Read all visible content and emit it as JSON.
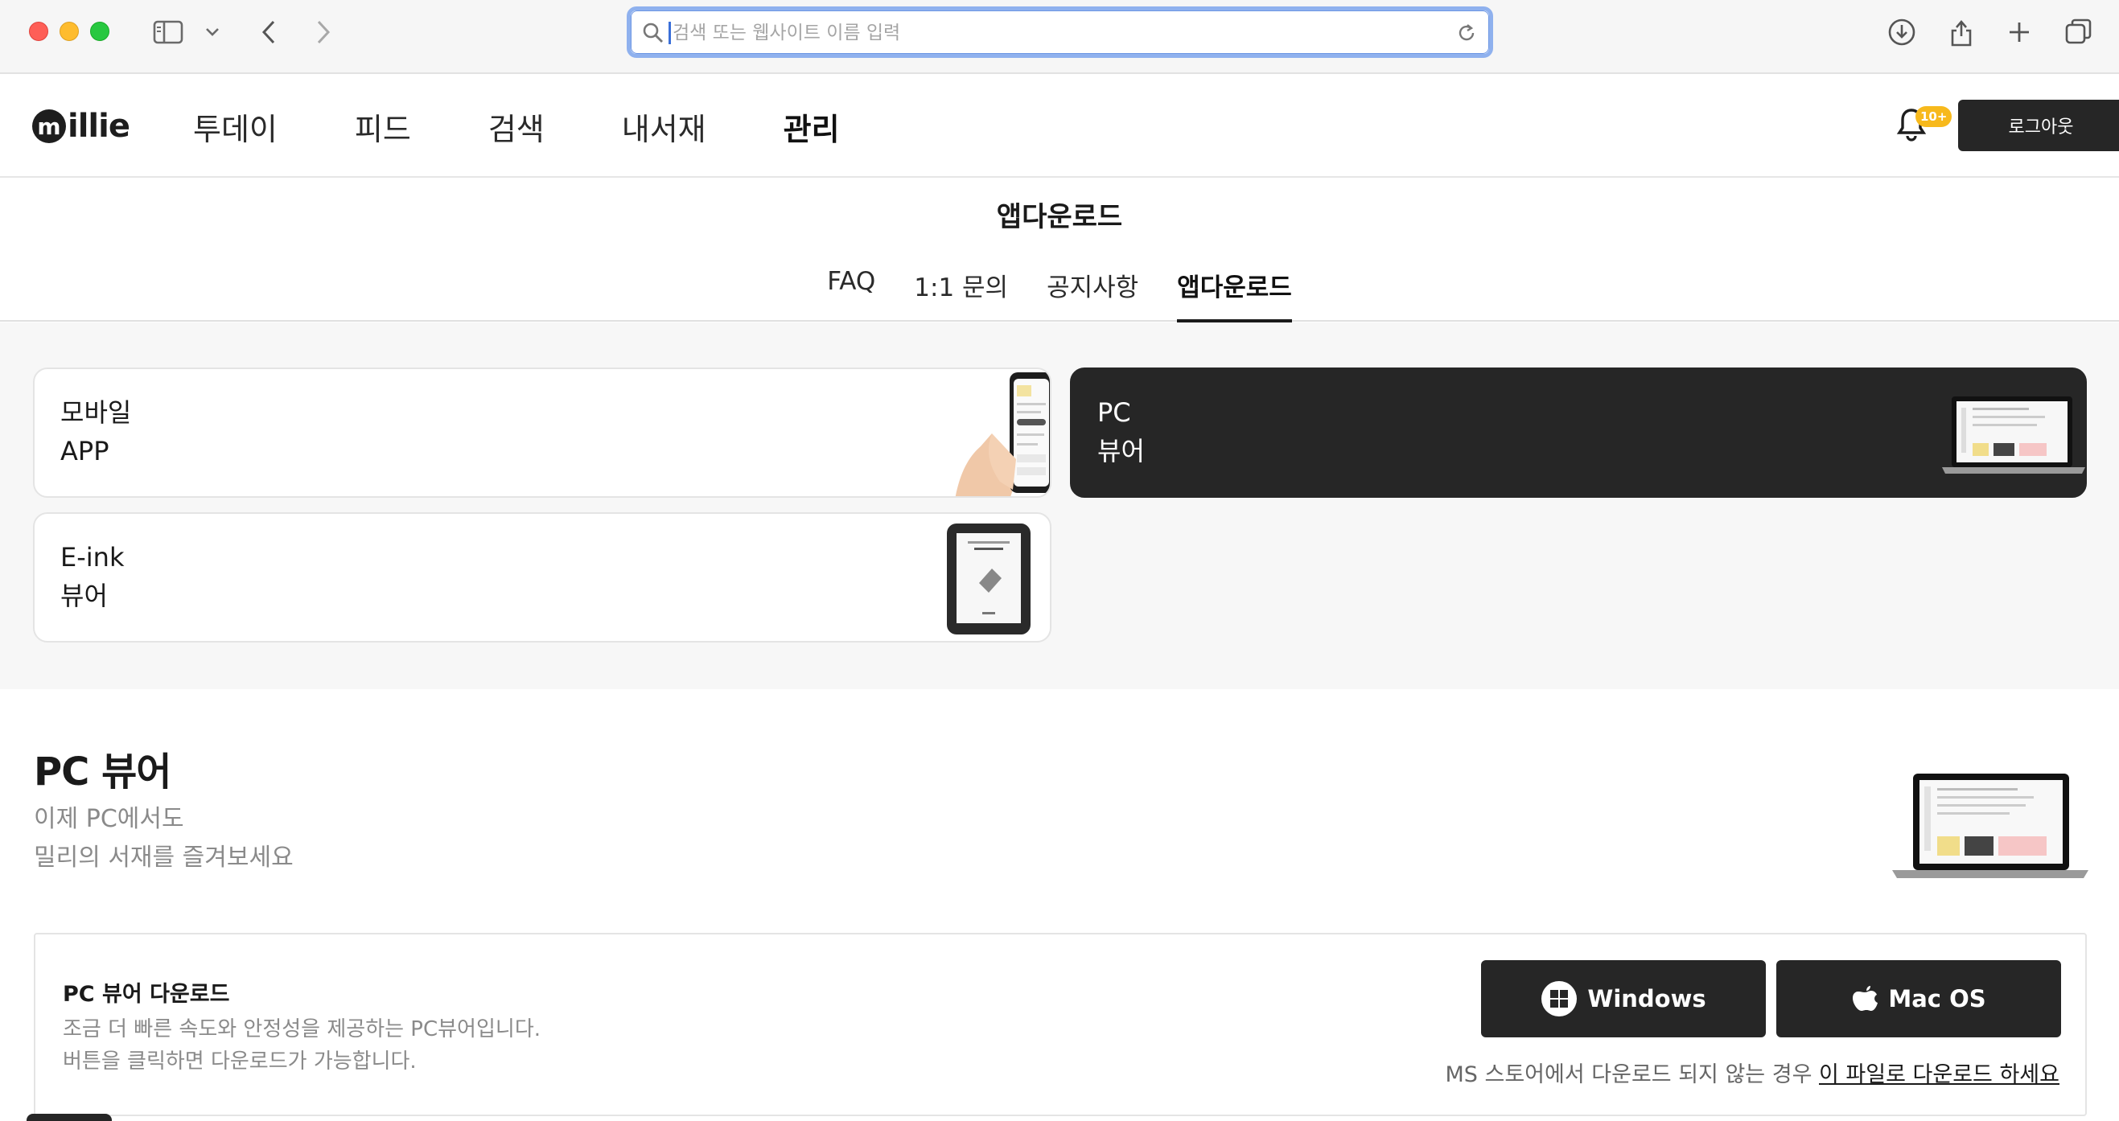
{
  "browser": {
    "address_placeholder": "검색 또는 웹사이트 이름 입력"
  },
  "site": {
    "logo_mark": "m",
    "logo_text": "illie",
    "nav": [
      {
        "label": "투데이"
      },
      {
        "label": "피드"
      },
      {
        "label": "검색"
      },
      {
        "label": "내서재"
      },
      {
        "label": "관리",
        "active": true
      }
    ],
    "notification_badge": "10+",
    "logout_label": "로그아웃"
  },
  "page": {
    "title": "앱다운로드",
    "tabs": [
      {
        "label": "FAQ"
      },
      {
        "label": "1:1 문의"
      },
      {
        "label": "공지사항"
      },
      {
        "label": "앱다운로드",
        "active": true
      }
    ]
  },
  "cards": {
    "mobile": {
      "line1": "모바일",
      "line2": "APP"
    },
    "pc": {
      "line1": "PC",
      "line2": "뷰어"
    },
    "eink": {
      "line1": "E-ink",
      "line2": "뷰어"
    }
  },
  "pc_viewer": {
    "title": "PC 뷰어",
    "subtitle_line1": "이제 PC에서도",
    "subtitle_line2": "밀리의 서재를 즐겨보세요",
    "download": {
      "title": "PC 뷰어 다운로드",
      "desc_line1": "조금 더 빠른 속도와 안정성을 제공하는 PC뷰어입니다.",
      "desc_line2": "버튼을 클릭하면 다운로드가 가능합니다.",
      "windows_label": "Windows",
      "mac_label": "Mac OS",
      "note_prefix": "MS 스토어에서 다운로드 되지 않는 경우 ",
      "note_link": "이 파일로 다운로드 하세요"
    }
  },
  "colors": {
    "dark": "#262626",
    "badge": "#f7b91c",
    "address_focus": "#8fb1ee"
  }
}
